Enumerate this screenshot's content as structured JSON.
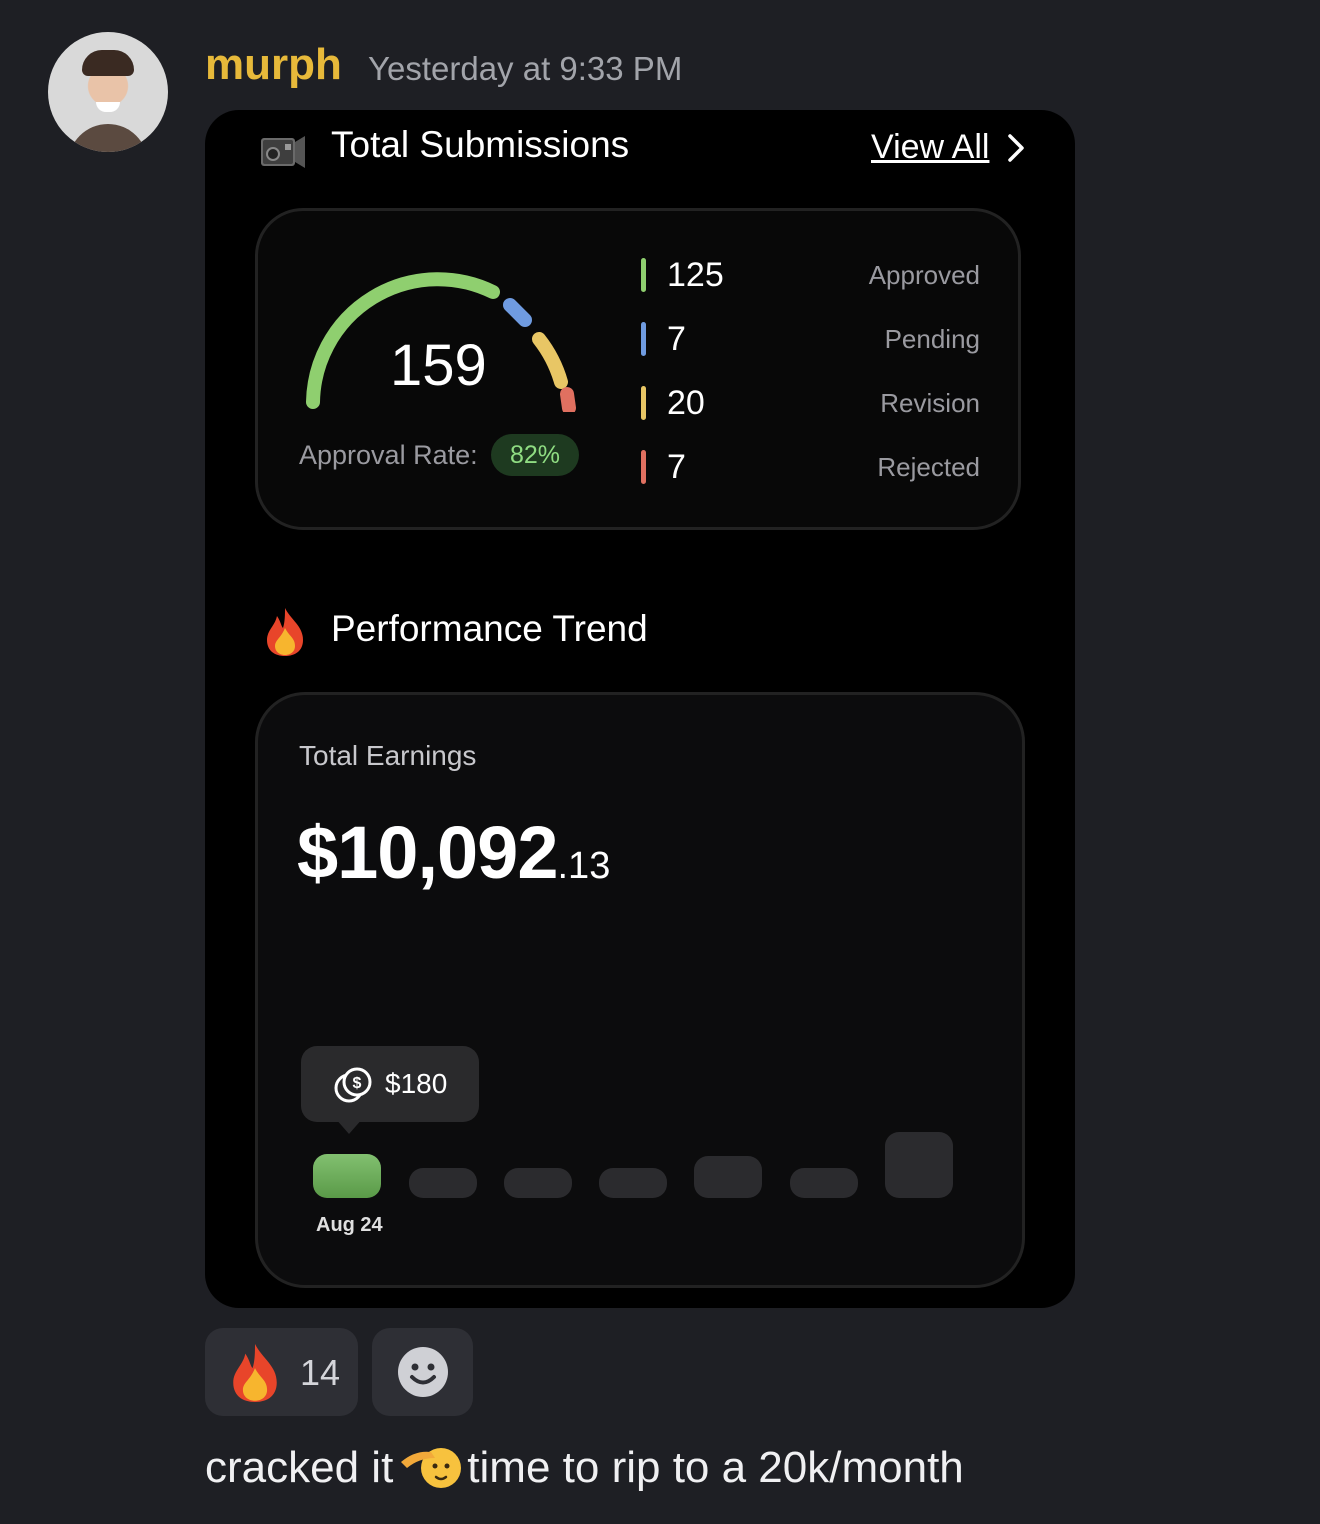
{
  "message": {
    "author": "murph",
    "timestamp": "Yesterday at 9:33 PM",
    "text_before_emoji": "cracked it",
    "text_after_emoji": "time to rip to a 20k/month",
    "inline_emoji": "saluting-face-icon"
  },
  "card": {
    "submissions_title": "Total Submissions",
    "view_all": "View All",
    "total": "159",
    "approval_rate_label": "Approval Rate:",
    "approval_rate_value": "82%",
    "stats": [
      {
        "value": "125",
        "label": "Approved",
        "color": "#8fcf6f"
      },
      {
        "value": "7",
        "label": "Pending",
        "color": "#6f9be0"
      },
      {
        "value": "20",
        "label": "Revision",
        "color": "#e8c665"
      },
      {
        "value": "7",
        "label": "Rejected",
        "color": "#e07060"
      }
    ],
    "performance_title": "Performance Trend",
    "earnings_label": "Total Earnings",
    "earnings_main": "$10,092",
    "earnings_cents": ".13",
    "tooltip_value": "$180",
    "active_bar_label": "Aug 24"
  },
  "reactions": [
    {
      "emoji": "fire-icon",
      "count": "14"
    }
  ],
  "colors": {
    "username": "#e7b93a",
    "background": "#1e1f24",
    "approved": "#8fcf6f",
    "pending": "#6f9be0",
    "revision": "#e8c665",
    "rejected": "#e07060"
  }
}
